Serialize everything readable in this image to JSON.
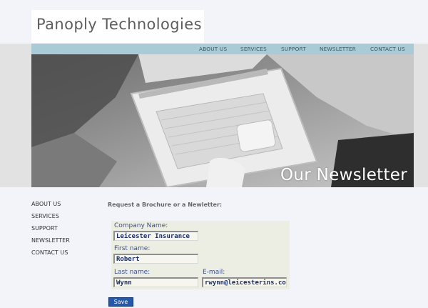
{
  "site": {
    "logo_text": "Panoply Technologies"
  },
  "top_nav": [
    {
      "label": "ABOUT US"
    },
    {
      "label": "SERVICES"
    },
    {
      "label": "SUPPORT"
    },
    {
      "label": "NEWSLETTER"
    },
    {
      "label": "CONTACT US"
    }
  ],
  "hero": {
    "title": "Our Newsletter",
    "image_subject": "laptop-on-lap-photo"
  },
  "side_nav": [
    {
      "label": "ABOUT US"
    },
    {
      "label": "SERVICES"
    },
    {
      "label": "SUPPORT"
    },
    {
      "label": "NEWSLETTER"
    },
    {
      "label": "CONTACT US"
    }
  ],
  "form": {
    "heading": "Request a Brochure or a Newletter:",
    "fields": {
      "company": {
        "label": "Company Name:",
        "value": "Leicester Insurance"
      },
      "first_name": {
        "label": "First name:",
        "value": "Robert"
      },
      "last_name": {
        "label": "Last name:",
        "value": "Wynn"
      },
      "email": {
        "label": "E-mail:",
        "value": "rwynn@leicesterins.co.uk"
      }
    },
    "save_label": "Save"
  },
  "colors": {
    "page_background": "#f3f4fa",
    "nav_bar": "#a9cbd7",
    "field_label": "#3b4f8c",
    "button": "#2458a8"
  }
}
